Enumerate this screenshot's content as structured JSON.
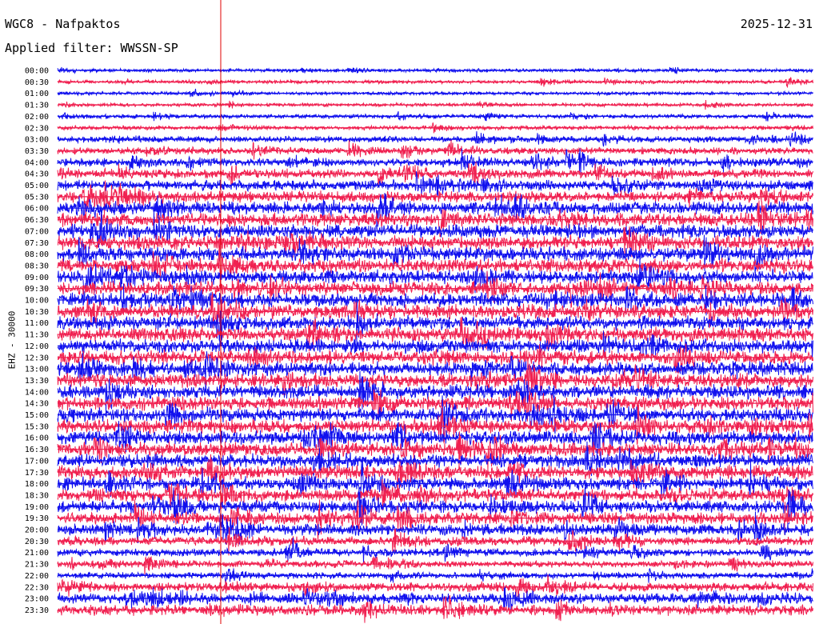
{
  "header": {
    "station": "WGC8 - Nafpaktos",
    "date": "2025-12-31",
    "filter": "Applied filter: WWSSN-SP",
    "channel": "EHZ - 30000"
  },
  "colors": {
    "trace_a": "#1010ee",
    "trace_b": "#f02050",
    "marker": "#e00000",
    "text": "#000000",
    "background": "#ffffff"
  },
  "chart_data": {
    "type": "line",
    "title": "WGC8 - Nafpaktos",
    "subtitle": "Applied filter: WWSSN-SP",
    "ylabel": "EHZ - 30000",
    "xlabel": "",
    "grid": false,
    "row_interval_minutes": 30,
    "rows": [
      {
        "label": "00:00",
        "color": "blue",
        "amplitude": 0.25
      },
      {
        "label": "00:30",
        "color": "red",
        "amplitude": 0.25
      },
      {
        "label": "01:00",
        "color": "blue",
        "amplitude": 0.25
      },
      {
        "label": "01:30",
        "color": "red",
        "amplitude": 0.25
      },
      {
        "label": "02:00",
        "color": "blue",
        "amplitude": 0.3
      },
      {
        "label": "02:30",
        "color": "red",
        "amplitude": 0.3
      },
      {
        "label": "03:00",
        "color": "blue",
        "amplitude": 0.45
      },
      {
        "label": "03:30",
        "color": "red",
        "amplitude": 0.5
      },
      {
        "label": "04:00",
        "color": "blue",
        "amplitude": 0.6
      },
      {
        "label": "04:30",
        "color": "red",
        "amplitude": 0.65
      },
      {
        "label": "05:00",
        "color": "blue",
        "amplitude": 0.75
      },
      {
        "label": "05:30",
        "color": "red",
        "amplitude": 0.8
      },
      {
        "label": "06:00",
        "color": "blue",
        "amplitude": 0.9
      },
      {
        "label": "06:30",
        "color": "red",
        "amplitude": 0.95
      },
      {
        "label": "07:00",
        "color": "blue",
        "amplitude": 1.0
      },
      {
        "label": "07:30",
        "color": "red",
        "amplitude": 1.0
      },
      {
        "label": "08:00",
        "color": "blue",
        "amplitude": 1.0
      },
      {
        "label": "08:30",
        "color": "red",
        "amplitude": 1.0
      },
      {
        "label": "09:00",
        "color": "blue",
        "amplitude": 1.0
      },
      {
        "label": "09:30",
        "color": "red",
        "amplitude": 1.0
      },
      {
        "label": "10:00",
        "color": "blue",
        "amplitude": 1.0
      },
      {
        "label": "10:30",
        "color": "red",
        "amplitude": 1.0
      },
      {
        "label": "11:00",
        "color": "blue",
        "amplitude": 1.0
      },
      {
        "label": "11:30",
        "color": "red",
        "amplitude": 1.0
      },
      {
        "label": "12:00",
        "color": "blue",
        "amplitude": 1.0
      },
      {
        "label": "12:30",
        "color": "red",
        "amplitude": 1.0
      },
      {
        "label": "13:00",
        "color": "blue",
        "amplitude": 1.0
      },
      {
        "label": "13:30",
        "color": "red",
        "amplitude": 1.0
      },
      {
        "label": "14:00",
        "color": "blue",
        "amplitude": 1.0
      },
      {
        "label": "14:30",
        "color": "red",
        "amplitude": 1.0
      },
      {
        "label": "15:00",
        "color": "blue",
        "amplitude": 1.0
      },
      {
        "label": "15:30",
        "color": "red",
        "amplitude": 1.0
      },
      {
        "label": "16:00",
        "color": "blue",
        "amplitude": 1.0
      },
      {
        "label": "16:30",
        "color": "red",
        "amplitude": 1.0
      },
      {
        "label": "17:00",
        "color": "blue",
        "amplitude": 1.0
      },
      {
        "label": "17:30",
        "color": "red",
        "amplitude": 1.0
      },
      {
        "label": "18:00",
        "color": "blue",
        "amplitude": 0.95
      },
      {
        "label": "18:30",
        "color": "red",
        "amplitude": 0.9
      },
      {
        "label": "19:00",
        "color": "blue",
        "amplitude": 0.9
      },
      {
        "label": "19:30",
        "color": "red",
        "amplitude": 0.85
      },
      {
        "label": "20:00",
        "color": "blue",
        "amplitude": 0.8
      },
      {
        "label": "20:30",
        "color": "red",
        "amplitude": 0.65
      },
      {
        "label": "21:00",
        "color": "blue",
        "amplitude": 0.55
      },
      {
        "label": "21:30",
        "color": "red",
        "amplitude": 0.5
      },
      {
        "label": "22:00",
        "color": "blue",
        "amplitude": 0.45
      },
      {
        "label": "22:30",
        "color": "red",
        "amplitude": 0.65
      },
      {
        "label": "23:00",
        "color": "blue",
        "amplitude": 0.75
      },
      {
        "label": "23:30",
        "color": "red",
        "amplitude": 0.75
      }
    ]
  }
}
